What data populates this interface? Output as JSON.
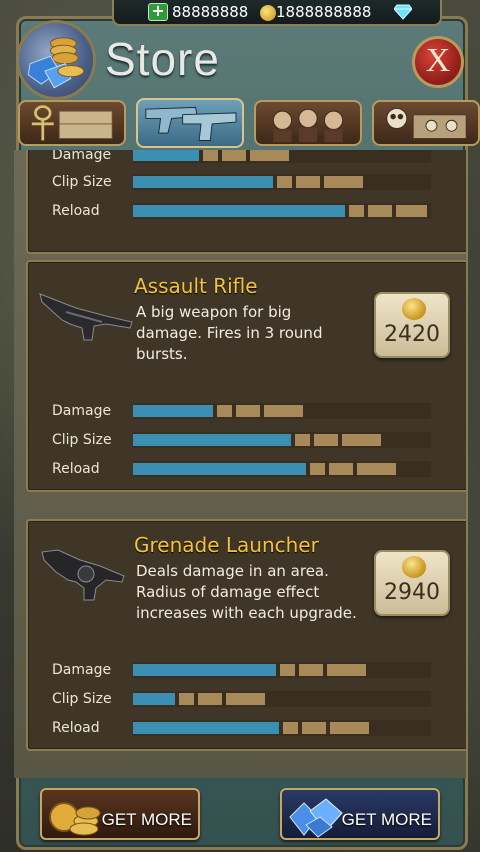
{
  "currency": {
    "cash_value": "88888888",
    "gold_value": "1888888888"
  },
  "header": {
    "title": "Store",
    "close_label": "X"
  },
  "tabs": [
    {
      "name": "tab-misc"
    },
    {
      "name": "tab-weapons"
    },
    {
      "name": "tab-characters"
    },
    {
      "name": "tab-traps"
    }
  ],
  "partial_item": {
    "stats": [
      {
        "label": "Damage",
        "fill": 0.22,
        "segments": 3
      },
      {
        "label": "Clip Size",
        "fill": 0.47,
        "segments": 3
      },
      {
        "label": "Reload",
        "fill": 0.71,
        "segments": 3
      }
    ]
  },
  "items": [
    {
      "name": "Assault Rifle",
      "description_lines": [
        "A big weapon for big",
        "damage.  Fires in 3 round",
        "bursts."
      ],
      "price": "2420",
      "stats": [
        {
          "label": "Damage",
          "fill": 0.27,
          "segments": 3
        },
        {
          "label": "Clip Size",
          "fill": 0.53,
          "segments": 3
        },
        {
          "label": "Reload",
          "fill": 0.58,
          "segments": 3
        }
      ]
    },
    {
      "name": "Grenade Launcher",
      "description_lines": [
        "Deals damage in an area.",
        "Radius of damage effect",
        "increases with each upgrade."
      ],
      "price": "2940",
      "stats": [
        {
          "label": "Damage",
          "fill": 0.48,
          "segments": 3
        },
        {
          "label": "Clip Size",
          "fill": 0.14,
          "segments": 3
        },
        {
          "label": "Reload",
          "fill": 0.49,
          "segments": 3
        }
      ]
    }
  ],
  "footer": {
    "gold_button_label": "GET MORE",
    "gems_button_label": "GET MORE"
  }
}
